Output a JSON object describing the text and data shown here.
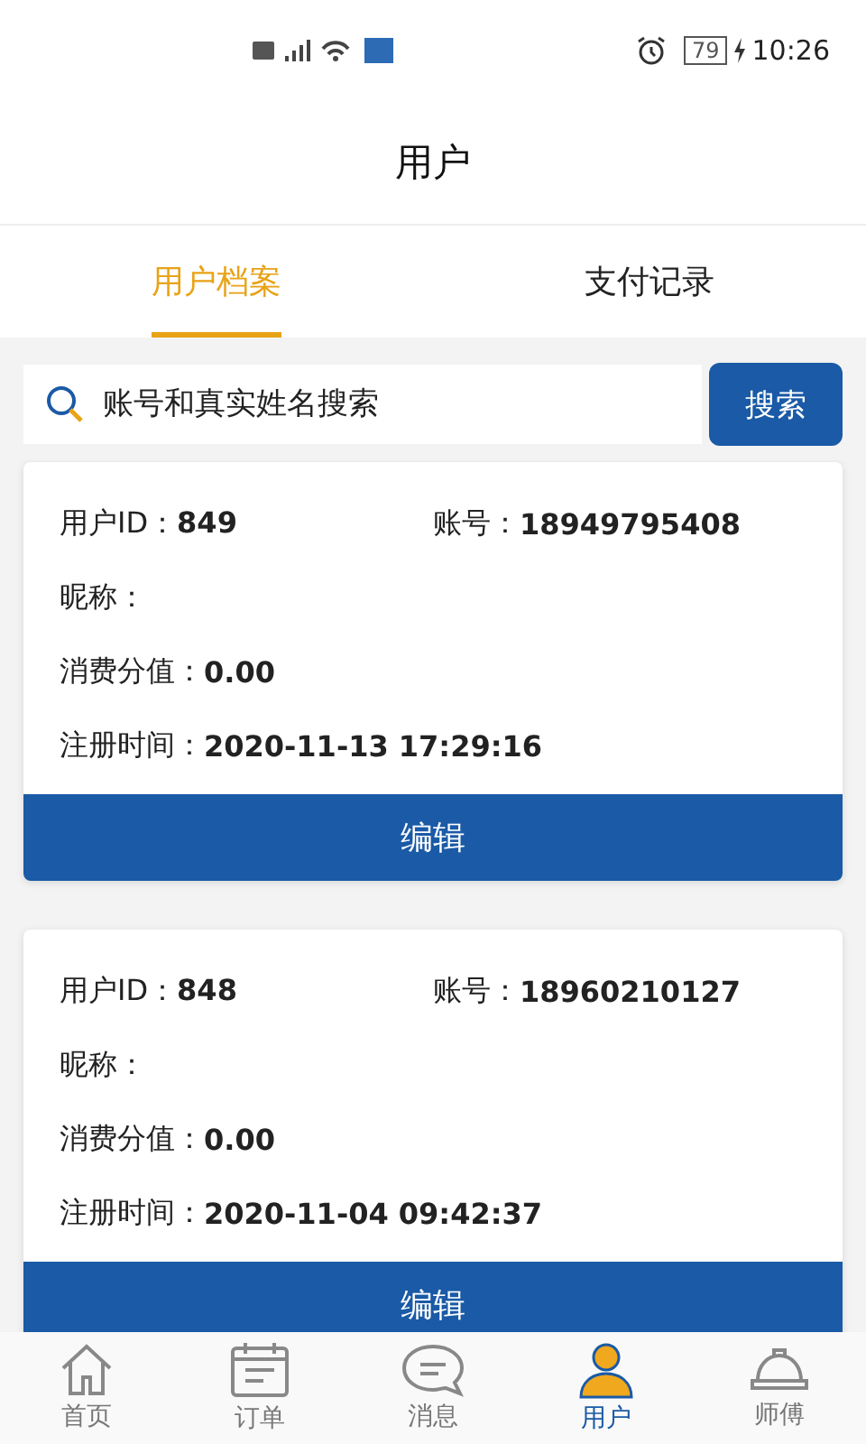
{
  "status_bar": {
    "battery": "79",
    "time": "10:26"
  },
  "header": {
    "title": "用户"
  },
  "tabs": [
    {
      "label": "用户档案",
      "selected": true
    },
    {
      "label": "支付记录",
      "selected": false
    }
  ],
  "search": {
    "placeholder": "账号和真实姓名搜索",
    "button": "搜索"
  },
  "users": [
    {
      "id_label": "用户ID：",
      "id": "849",
      "account_label": "账号：",
      "account": "18949795408",
      "nickname_label": "昵称：",
      "points_label": "消费分值：",
      "points": "0.00",
      "registered_label": "注册时间：",
      "registered": "2020-11-13 17:29:16",
      "edit": "编辑"
    },
    {
      "id_label": "用户ID：",
      "id": "848",
      "account_label": "账号：",
      "account": "18960210127",
      "nickname_label": "昵称：",
      "points_label": "消费分值：",
      "points": "0.00",
      "registered_label": "注册时间：",
      "registered": "2020-11-04 09:42:37",
      "edit": "编辑"
    }
  ],
  "nav": [
    {
      "kind": "home",
      "label": "首页",
      "selected": false
    },
    {
      "kind": "orders",
      "label": "订单",
      "selected": false
    },
    {
      "kind": "messages",
      "label": "消息",
      "selected": false
    },
    {
      "kind": "user",
      "label": "用户",
      "selected": true
    },
    {
      "kind": "master",
      "label": "师傅",
      "selected": false
    }
  ]
}
